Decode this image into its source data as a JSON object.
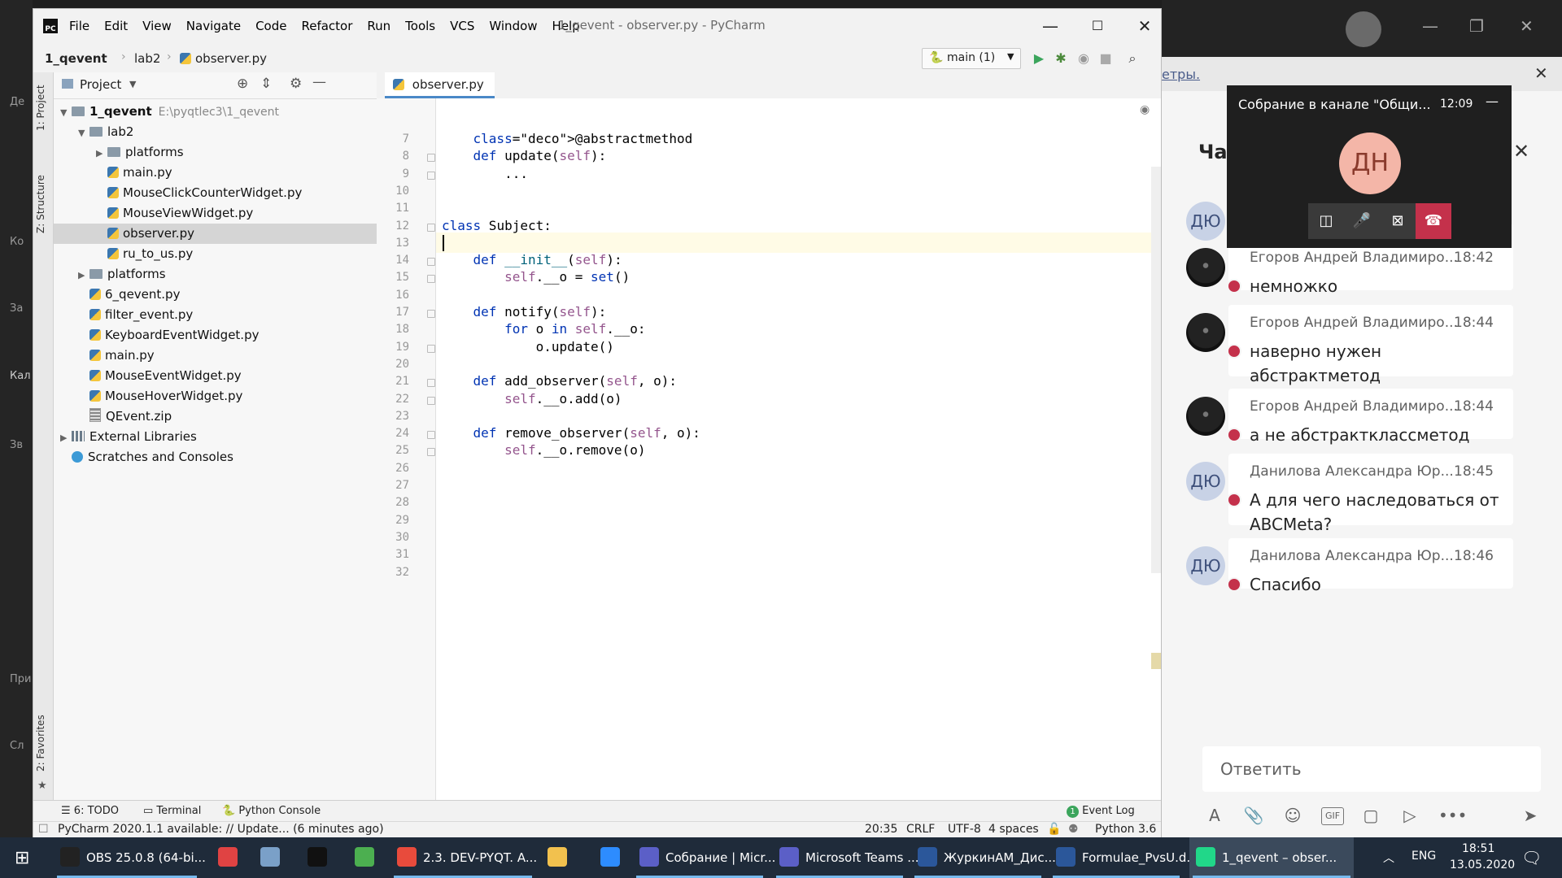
{
  "pycharm": {
    "menu": [
      "File",
      "Edit",
      "View",
      "Navigate",
      "Code",
      "Refactor",
      "Run",
      "Tools",
      "VCS",
      "Window",
      "Help"
    ],
    "window_title": "1_qevent - observer.py - PyCharm",
    "breadcrumbs": [
      "1_qevent",
      "lab2",
      "observer.py"
    ],
    "run_config": "main (1)",
    "left_tabs": [
      "1: Project",
      "Z: Structure",
      "2: Favorites"
    ],
    "project_header": "Project",
    "tree": [
      {
        "label": "1_qevent",
        "path": "E:\\pyqtlec3\\1_qevent",
        "type": "folder",
        "depth": 0,
        "expanded": true,
        "bold": true
      },
      {
        "label": "lab2",
        "type": "folder",
        "depth": 1,
        "expanded": true
      },
      {
        "label": "platforms",
        "type": "folder",
        "depth": 2,
        "expanded": false
      },
      {
        "label": "main.py",
        "type": "py",
        "depth": 2
      },
      {
        "label": "MouseClickCounterWidget.py",
        "type": "py",
        "depth": 2
      },
      {
        "label": "MouseViewWidget.py",
        "type": "py",
        "depth": 2
      },
      {
        "label": "observer.py",
        "type": "py",
        "depth": 2,
        "selected": true
      },
      {
        "label": "ru_to_us.py",
        "type": "py",
        "depth": 2
      },
      {
        "label": "platforms",
        "type": "folder",
        "depth": 1,
        "expanded": false
      },
      {
        "label": "6_qevent.py",
        "type": "py",
        "depth": 1
      },
      {
        "label": "filter_event.py",
        "type": "py",
        "depth": 1
      },
      {
        "label": "KeyboardEventWidget.py",
        "type": "py",
        "depth": 1
      },
      {
        "label": "main.py",
        "type": "py",
        "depth": 1
      },
      {
        "label": "MouseEventWidget.py",
        "type": "py",
        "depth": 1
      },
      {
        "label": "MouseHoverWidget.py",
        "type": "py",
        "depth": 1
      },
      {
        "label": "QEvent.zip",
        "type": "zip",
        "depth": 1
      },
      {
        "label": "External Libraries",
        "type": "lib",
        "depth": 0,
        "expanded": false
      },
      {
        "label": "Scratches and Consoles",
        "type": "scratch",
        "depth": 0
      }
    ],
    "editor_tab": "observer.py",
    "code_lines": [
      {
        "n": "7",
        "text": "    @abstractmethod"
      },
      {
        "n": "8",
        "text": "    def update(self):"
      },
      {
        "n": "9",
        "text": "        ..."
      },
      {
        "n": "10",
        "text": ""
      },
      {
        "n": "11",
        "text": ""
      },
      {
        "n": "12",
        "text": "class Subject:"
      },
      {
        "n": "13",
        "text": ""
      },
      {
        "n": "14",
        "text": "    def __init__(self):"
      },
      {
        "n": "15",
        "text": "        self.__o = set()"
      },
      {
        "n": "16",
        "text": ""
      },
      {
        "n": "17",
        "text": "    def notify(self):"
      },
      {
        "n": "18",
        "text": "        for o in self.__o:"
      },
      {
        "n": "19",
        "text": "            o.update()"
      },
      {
        "n": "20",
        "text": ""
      },
      {
        "n": "21",
        "text": "    def add_observer(self, o):"
      },
      {
        "n": "22",
        "text": "        self.__o.add(o)"
      },
      {
        "n": "23",
        "text": ""
      },
      {
        "n": "24",
        "text": "    def remove_observer(self, o):"
      },
      {
        "n": "25",
        "text": "        self.__o.remove(o)"
      },
      {
        "n": "26",
        "text": ""
      },
      {
        "n": "27",
        "text": ""
      },
      {
        "n": "28",
        "text": ""
      },
      {
        "n": "29",
        "text": ""
      },
      {
        "n": "30",
        "text": ""
      },
      {
        "n": "31",
        "text": ""
      },
      {
        "n": "32",
        "text": ""
      }
    ],
    "bottom_tabs": {
      "todo": "6: TODO",
      "terminal": "Terminal",
      "console": "Python Console",
      "event_log": "Event Log",
      "event_count": "1"
    },
    "status": {
      "message": "PyCharm 2020.1.1 available: // Update... (6 minutes ago)",
      "position": "20:35",
      "line_sep": "CRLF",
      "encoding": "UTF-8",
      "indent": "4 spaces",
      "interpreter": "Python 3.6"
    }
  },
  "teams": {
    "banner_link": "етры.",
    "chat_title_partial": "Ча",
    "meeting": {
      "title": "Собрание в канале \"Общи...",
      "time": "12:09",
      "initials": "ДН"
    },
    "top_partial": {
      "initials": "ДЮ",
      "text": "+-"
    },
    "messages": [
      {
        "author": "Егоров Андрей Владимиро...",
        "time": "18:42",
        "text": "немножко",
        "avatar": "img"
      },
      {
        "author": "Егоров Андрей Владимиро...",
        "time": "18:44",
        "text": "наверно нужен абстрактметод",
        "avatar": "img"
      },
      {
        "author": "Егоров Андрей Владимиро...",
        "time": "18:44",
        "text": "а не абстрактклассметод",
        "avatar": "img"
      },
      {
        "author": "Данилова Александра Юр...",
        "time": "18:45",
        "text": "А для чего наследоваться от ABCMeta?",
        "avatar": "ДЮ"
      },
      {
        "author": "Данилова Александра Юр...",
        "time": "18:46",
        "text": "Спасибо",
        "avatar": "ДЮ"
      }
    ],
    "reply_placeholder": "Ответить",
    "composer_icons": [
      "format-icon",
      "attach-icon",
      "emoji-icon",
      "gif-icon",
      "sticker-icon",
      "schedule-icon",
      "more-icon",
      "send-icon"
    ]
  },
  "background_app_labels": [
    "Де",
    "Ко",
    "За",
    "Кал",
    "Зв",
    "При",
    "Сл"
  ],
  "taskbar": {
    "items": [
      {
        "label": "OBS 25.0.8 (64-bi...",
        "color": "#222222"
      },
      {
        "label": "",
        "color": "#e04343"
      },
      {
        "label": "",
        "color": "#7aa0c8"
      },
      {
        "label": "",
        "color": "#111111"
      },
      {
        "label": "",
        "color": "#4caf50"
      },
      {
        "label": "2.3. DEV-PYQT. A...",
        "color": "#e84b3c"
      },
      {
        "label": "",
        "color": "#f2c14e"
      },
      {
        "label": "",
        "color": "#2d8cff"
      },
      {
        "label": "Собрание | Micr...",
        "color": "#5b5fc7"
      },
      {
        "label": "Microsoft Teams ...",
        "color": "#5b5fc7"
      },
      {
        "label": "ЖуркинАМ_Дис...",
        "color": "#2b579a"
      },
      {
        "label": "Formulae_PvsU.d...",
        "color": "#2b579a"
      },
      {
        "label": "1_qevent – obser...",
        "color": "#21d789"
      }
    ],
    "lang": "ENG",
    "time": "18:51",
    "date": "13.05.2020"
  }
}
